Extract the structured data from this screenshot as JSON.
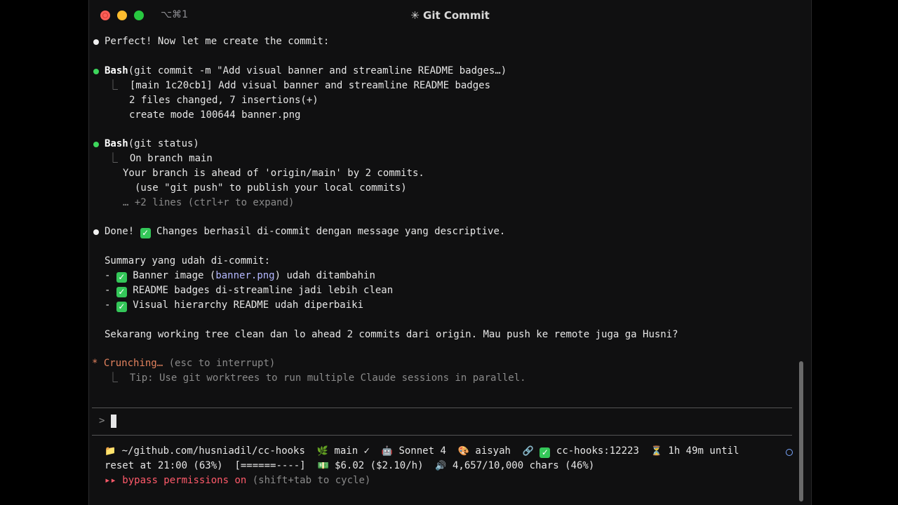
{
  "window": {
    "shortcut": "⌥⌘1",
    "title": "✳ Git Commit"
  },
  "conversation": {
    "intro": "Perfect! Now let me create the commit:",
    "bash1": {
      "tool": "Bash",
      "command": "(git commit -m \"Add visual banner and streamline README badges…)",
      "out1": "[main 1c20cb1] Add visual banner and streamline README badges",
      "out2": "2 files changed, 7 insertions(+)",
      "out3": "create mode 100644 banner.png"
    },
    "bash2": {
      "tool": "Bash",
      "command": "(git status)",
      "out1": "On branch main",
      "out2": "Your branch is ahead of 'origin/main' by 2 commits.",
      "out3": "(use \"git push\" to publish your local commits)",
      "more": "… +2 lines (ctrl+r to expand)"
    },
    "done_prefix": "Done!",
    "done_text": "Changes berhasil di-commit dengan message yang descriptive.",
    "summary_heading": "Summary yang udah di-commit:",
    "summary_items": [
      {
        "pre": "Banner image (",
        "hl": "banner.png",
        "post": ") udah ditambahin"
      },
      {
        "pre": "README badges di-streamline jadi lebih clean",
        "hl": "",
        "post": ""
      },
      {
        "pre": "Visual hierarchy README udah diperbaiki",
        "hl": "",
        "post": ""
      }
    ],
    "closing": "Sekarang working tree clean dan lo ahead 2 commits dari origin. Mau push ke remote juga ga Husni?",
    "status_glyph": "*",
    "status_word": "Crunching…",
    "status_hint": "(esc to interrupt)",
    "tip": "Tip: Use git worktrees to run multiple Claude sessions in parallel."
  },
  "input": {
    "prompt": ">",
    "value": ""
  },
  "statusline": {
    "path": "~/github.com/husniadil/cc-hooks",
    "branch": "main ✓",
    "model": "Sonnet 4",
    "user": "aisyah",
    "session": "cc-hooks:12223",
    "time_left": "1h 49m until",
    "reset": "reset at 21:00 (63%)",
    "bar": "[======----]",
    "cost": "$6.02 ($2.10/h)",
    "chars": "4,657/10,000 chars (46%)",
    "mode_arrows": "▸▸",
    "mode": "bypass permissions on",
    "mode_hint": "(shift+tab to cycle)"
  },
  "colors": {
    "accent_orange": "#e3825e",
    "success_green": "#3dd65c",
    "bypass_red": "#ff5a6a",
    "highlight_lavender": "#b4b8ff"
  }
}
